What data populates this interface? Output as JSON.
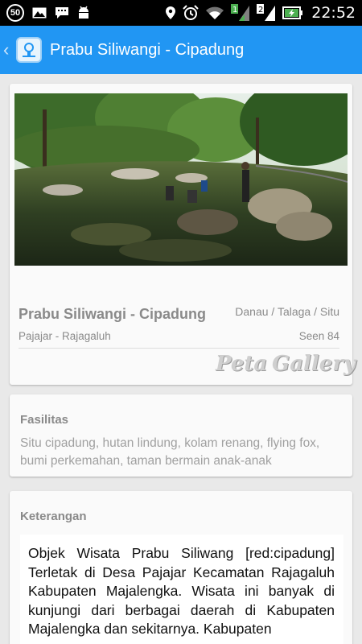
{
  "status_bar": {
    "notification_count": "50",
    "time": "22:52",
    "signal_labels": [
      "1",
      "2"
    ],
    "icons": [
      "notification-count-icon",
      "image-icon",
      "chat-icon",
      "android-debug-icon",
      "location-icon",
      "alarm-icon",
      "wifi-icon",
      "signal-icon",
      "signal-icon",
      "battery-charging-icon"
    ]
  },
  "app_bar": {
    "title": "Prabu Siliwangi - Cipadung",
    "back_icon": "chevron-left-icon",
    "logo_icon": "app-logo-icon"
  },
  "detail": {
    "title": "Prabu Siliwangi - Cipadung",
    "category": "Danau / Talaga / Situ",
    "location": "Pajajar - Rajagaluh",
    "seen": "Seen 84",
    "map_label": "Peta",
    "gallery_label": "Gallery"
  },
  "facilities": {
    "heading": "Fasilitas",
    "text": "Situ cipadung, hutan lindung, kolam renang, flying fox, bumi perkemahan, taman bermain anak-anak"
  },
  "description": {
    "heading": "Keterangan",
    "text": "Objek Wisata Prabu Siliwang [red:cipadung] Terletak di Desa Pajajar Kecamatan Rajagaluh Kabupaten Majalengka. Wisata ini banyak di kunjungi dari berbagai daerah di Kabupaten Majalengka dan sekitarnya. Kabupaten"
  },
  "colors": {
    "primary": "#2196f3",
    "status_bar": "#000000",
    "background": "#e9e9e9",
    "card": "#fafafa",
    "muted_text": "#8a8a8a"
  }
}
